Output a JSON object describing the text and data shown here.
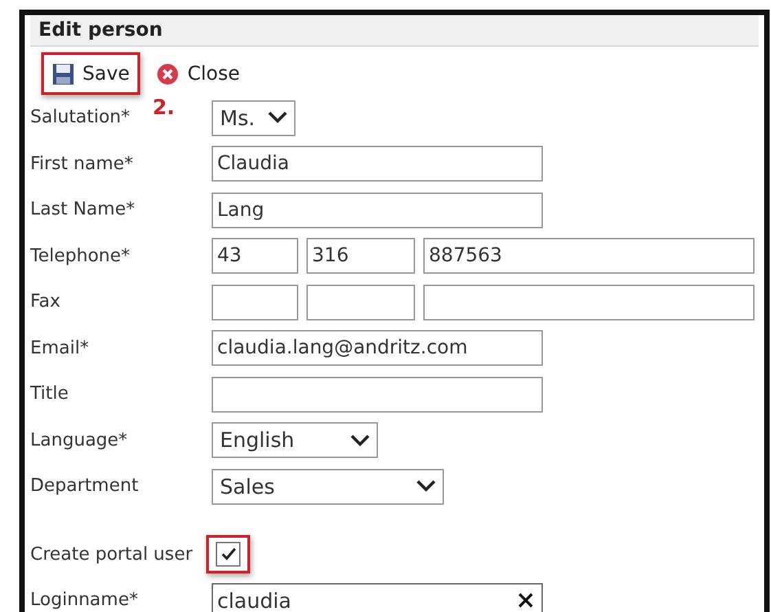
{
  "window": {
    "title": "Edit person"
  },
  "toolbar": {
    "buttons": [
      {
        "kind": "save",
        "label": "Save",
        "highlighted": true
      },
      {
        "kind": "close",
        "label": "Close",
        "highlighted": false
      }
    ],
    "annotation": "2."
  },
  "fields": [
    {
      "kind": "select",
      "label": "Salutation*",
      "value": "Ms."
    },
    {
      "kind": "text",
      "label": "First name*",
      "value": "Claudia"
    },
    {
      "kind": "text",
      "label": "Last Name*",
      "value": "Lang"
    },
    {
      "kind": "phone",
      "label": "Telephone*",
      "parts": [
        {
          "value": "43"
        },
        {
          "value": "316"
        },
        {
          "value": "887563"
        }
      ]
    },
    {
      "kind": "phone",
      "label": "Fax"
    },
    {
      "kind": "text",
      "label": "Email*",
      "value": "claudia.lang@andritz.com"
    },
    {
      "kind": "text",
      "label": "Title"
    },
    {
      "kind": "select",
      "label": "Language*",
      "value": "English"
    },
    {
      "kind": "select",
      "label": "Department",
      "value": "Sales"
    },
    {
      "kind": "checkbox",
      "label": "Create portal user",
      "checked": true,
      "highlighted": true
    },
    {
      "kind": "clearable",
      "label": "Loginname*",
      "value": "claudia"
    }
  ]
}
